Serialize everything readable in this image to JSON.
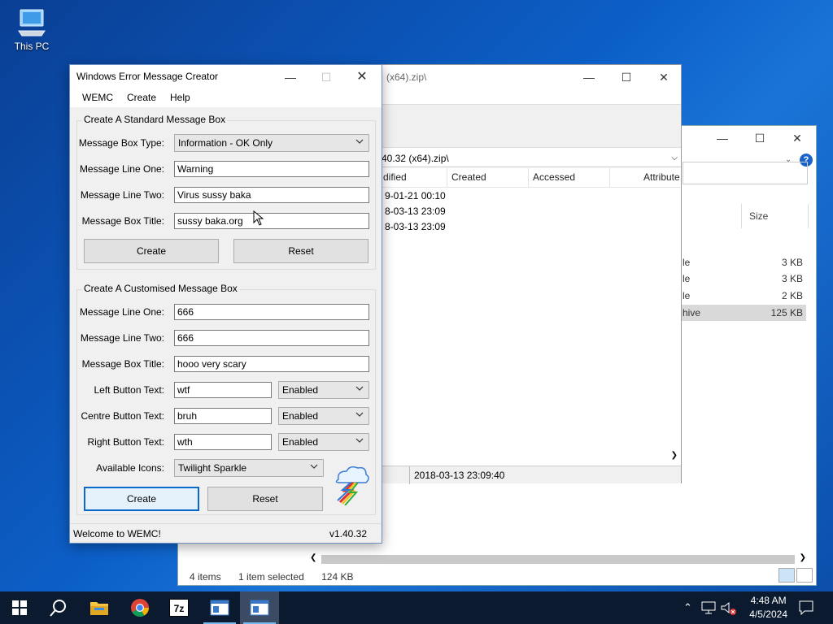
{
  "desktop": {
    "icon_label": "This PC"
  },
  "explorer": {
    "size_header": "Size",
    "rows": [
      {
        "type": "le",
        "size": "3 KB"
      },
      {
        "type": "le",
        "size": "3 KB"
      },
      {
        "type": "le",
        "size": "2 KB"
      },
      {
        "type": "hive",
        "size": "125 KB"
      }
    ],
    "status": {
      "items": "4 items",
      "selected": "1 item selected",
      "size": "124 KB"
    }
  },
  "zip": {
    "title": "(x64).zip\\",
    "path": "40.32 (x64).zip\\",
    "columns": [
      "dified",
      "Created",
      "Accessed",
      "Attribute"
    ],
    "rows": [
      "9-01-21 00:10",
      "8-03-13 23:09",
      "8-03-13 23:09"
    ],
    "status_time": "2018-03-13 23:09:40"
  },
  "wemc": {
    "title": "Windows Error Message Creator",
    "menu": [
      "WEMC",
      "Create",
      "Help"
    ],
    "standard": {
      "group_title": "Create A Standard Message Box",
      "type_label": "Message Box Type:",
      "type_value": "Information - OK Only",
      "line1_label": "Message Line One:",
      "line1_value": "Warning",
      "line2_label": "Message Line Two:",
      "line2_value": "Virus sussy baka",
      "title_label": "Message Box Title:",
      "title_value": "sussy baka.org",
      "create": "Create",
      "reset": "Reset"
    },
    "custom": {
      "group_title": "Create A Customised Message Box",
      "line1_label": "Message Line One:",
      "line1_value": "666",
      "line2_label": "Message Line Two:",
      "line2_value": "666",
      "title_label": "Message Box Title:",
      "title_value": "hooo very scary",
      "left_label": "Left Button Text:",
      "left_value": "wtf",
      "left_state": "Enabled",
      "centre_label": "Centre Button Text:",
      "centre_value": "bruh",
      "centre_state": "Enabled",
      "right_label": "Right Button Text:",
      "right_value": "wth",
      "right_state": "Enabled",
      "icons_label": "Available Icons:",
      "icons_value": "Twilight Sparkle",
      "create": "Create",
      "reset": "Reset"
    },
    "status_left": "Welcome to WEMC!",
    "status_right": "v1.40.32"
  },
  "taskbar": {
    "time": "4:48 AM",
    "date": "4/5/2024",
    "app_7z": "7z"
  }
}
